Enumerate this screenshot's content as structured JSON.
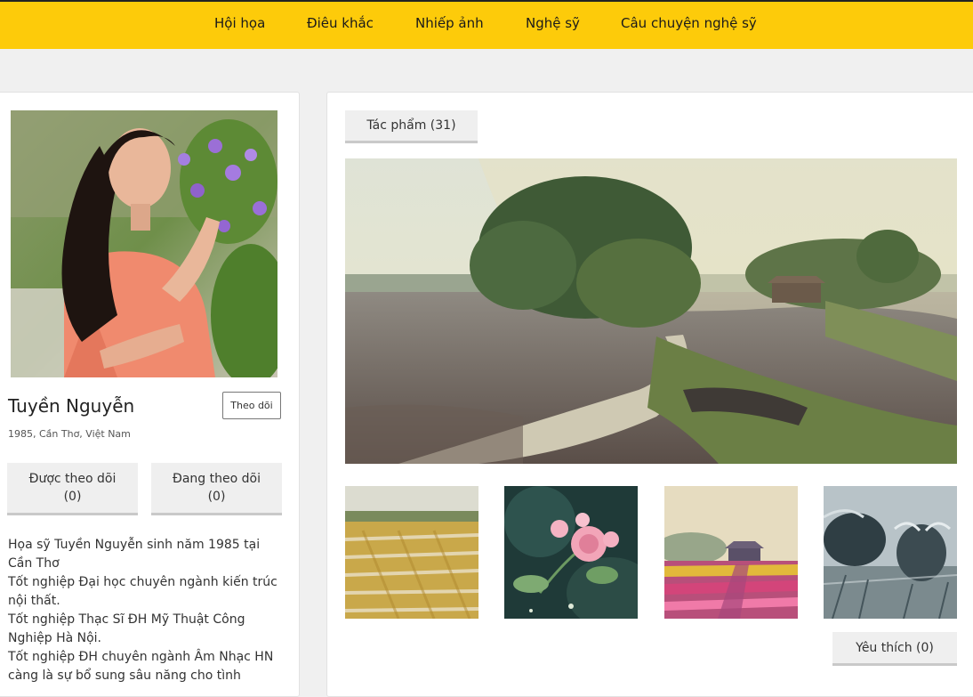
{
  "nav": {
    "items": [
      {
        "label": "Hội họa"
      },
      {
        "label": "Điêu khắc"
      },
      {
        "label": "Nhiếp ảnh"
      },
      {
        "label": "Nghệ sỹ"
      },
      {
        "label": "Câu chuyện nghệ sỹ"
      }
    ]
  },
  "artist": {
    "name": "Tuyền Nguyễn",
    "meta": "1985, Cần Thơ, Việt Nam",
    "follow_label": "Theo dõi",
    "followers_label": "Được theo dõi",
    "followers_count": "(0)",
    "following_label": "Đang theo dõi",
    "following_count": "(0)",
    "bio": [
      "Họa sỹ Tuyền Nguyễn sinh năm 1985 tại Cần Thơ",
      "Tốt nghiệp Đại học chuyên ngành kiến trúc nội thất.",
      "Tốt nghiệp Thạc Sĩ ĐH Mỹ Thuật Công Nghiệp Hà Nội.",
      "Tốt nghiệp ĐH chuyên ngành Âm Nhạc HN càng là sự bổ sung sâu năng cho tình"
    ]
  },
  "works": {
    "tab_label": "Tác phẩm (31)",
    "like_label": "Yêu thích (0)"
  },
  "colors": {
    "nav_bg": "#fdcb0a",
    "page_bg": "#f0f0f0",
    "button_bg": "#efefef"
  }
}
